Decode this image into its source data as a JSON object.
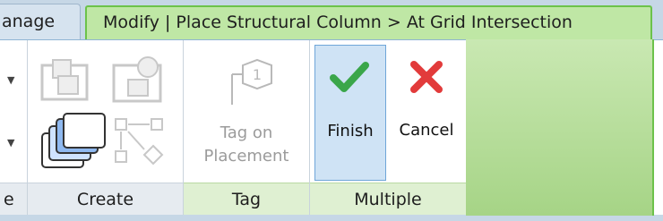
{
  "tabs": {
    "manage_label": "anage",
    "contextual_label": "Modify | Place Structural Column > At Grid Intersection"
  },
  "panels": {
    "left_partial_title": "e",
    "create_title": "Create",
    "tag_title": "Tag",
    "multiple_title": "Multiple"
  },
  "buttons": {
    "tag_on_placement_line1": "Tag on",
    "tag_on_placement_line2": "Placement",
    "finish_label": "Finish",
    "cancel_label": "Cancel"
  },
  "colors": {
    "contextual_tab": "#bfe7a5",
    "finish_check": "#3aa64a",
    "cancel_x": "#e23b3b"
  }
}
